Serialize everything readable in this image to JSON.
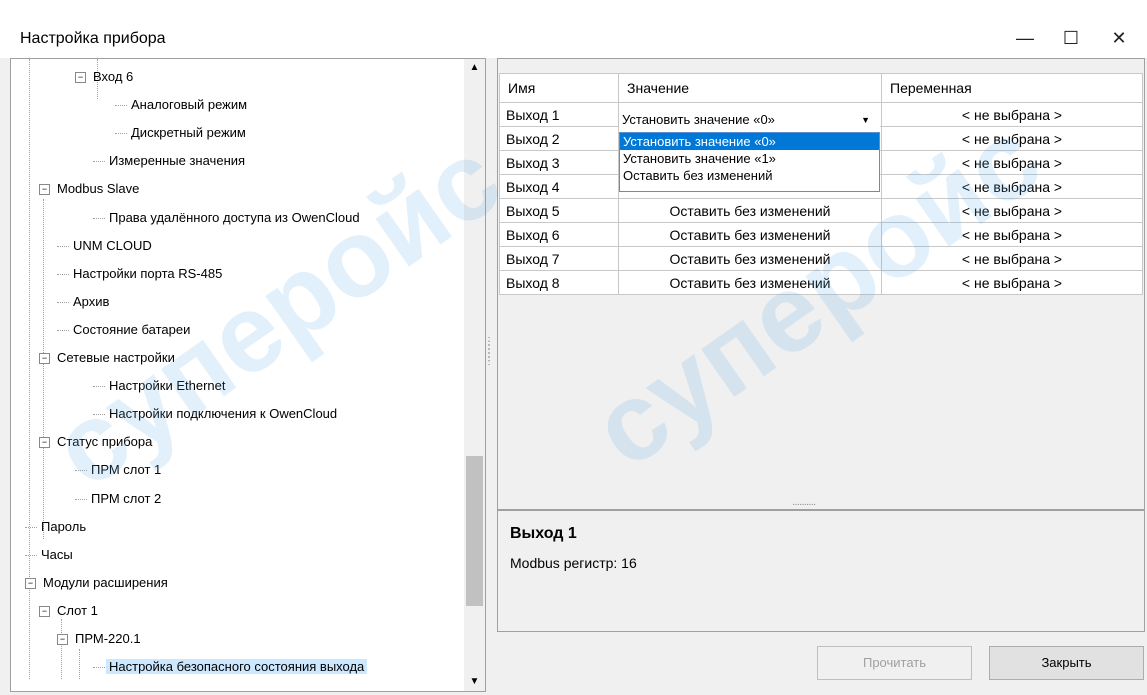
{
  "window": {
    "title": "Настройка прибора",
    "minimize": "—",
    "maximize": "☐",
    "close": "✕"
  },
  "watermark": "cyпeрoйc",
  "tree": {
    "items": [
      {
        "label": "Вход 6",
        "expander": "−"
      },
      {
        "label": "Аналоговый режим"
      },
      {
        "label": "Дискретный режим"
      },
      {
        "label": "Измеренные значения"
      },
      {
        "label": "Modbus Slave",
        "expander": "−"
      },
      {
        "label": "Права удалённого доступа из OwenCloud"
      },
      {
        "label": "UNM CLOUD"
      },
      {
        "label": "Настройки порта RS-485"
      },
      {
        "label": "Архив"
      },
      {
        "label": "Состояние батареи"
      },
      {
        "label": "Сетевые настройки",
        "expander": "−"
      },
      {
        "label": "Настройки Ethernet"
      },
      {
        "label": "Настройки подключения к OwenCloud"
      },
      {
        "label": "Статус прибора",
        "expander": "−"
      },
      {
        "label": "ПРМ слот 1"
      },
      {
        "label": "ПРМ слот 2"
      },
      {
        "label": "Пароль"
      },
      {
        "label": "Часы"
      },
      {
        "label": "Модули расширения",
        "expander": "−"
      },
      {
        "label": "Слот 1",
        "expander": "−"
      },
      {
        "label": "ПРМ-220.1",
        "expander": "−"
      },
      {
        "label": "Настройка безопасного состояния выхода"
      }
    ],
    "scroll_up": "▲",
    "scroll_down": "▼",
    "scroll_position": 0.85
  },
  "grid": {
    "headers": [
      "Имя",
      "Значение",
      "Переменная"
    ],
    "rows": [
      {
        "name": "Выход 1",
        "value": "Установить значение «0»",
        "variable": "< не выбрана >"
      },
      {
        "name": "Выход 2",
        "value": "",
        "variable": "< не выбрана >"
      },
      {
        "name": "Выход 3",
        "value": "",
        "variable": "< не выбрана >"
      },
      {
        "name": "Выход 4",
        "value": "Оставить без изменений",
        "variable": "< не выбрана >"
      },
      {
        "name": "Выход 5",
        "value": "Оставить без изменений",
        "variable": "< не выбрана >"
      },
      {
        "name": "Выход 6",
        "value": "Оставить без изменений",
        "variable": "< не выбрана >"
      },
      {
        "name": "Выход 7",
        "value": "Оставить без изменений",
        "variable": "< не выбрана >"
      },
      {
        "name": "Выход 8",
        "value": "Оставить без изменений",
        "variable": "< не выбрана >"
      }
    ],
    "combo_arrow": "▼",
    "dropdown_options": [
      "Установить значение «0»",
      "Установить значение «1»",
      "Оставить без изменений"
    ],
    "dropdown_selected_index": 0
  },
  "info": {
    "title": "Выход 1",
    "text": "Modbus регистр: 16"
  },
  "buttons": {
    "read": "Прочитать",
    "close": "Закрыть"
  },
  "colors": {
    "selection": "#0078d7",
    "tree_selection": "#cce8ff",
    "watermark": "#5aaae1"
  }
}
